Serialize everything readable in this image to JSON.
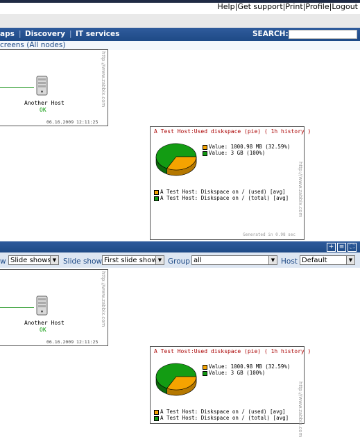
{
  "header": {
    "links": [
      "Help",
      "Get support",
      "Print",
      "Profile",
      "Logout"
    ]
  },
  "menu": {
    "items": [
      "aps",
      "Discovery",
      "IT services"
    ],
    "search_label": "SEARCH:",
    "search_value": ""
  },
  "breadcrumb": "creens (All nodes)",
  "map": {
    "host_label": "Another Host",
    "status": "OK",
    "timestamp": "06.16.2009 12:11:25",
    "watermark": "http://www.zabbix.com"
  },
  "graph": {
    "title": "A Test Host:Used diskspace (pie) ( 1h history )",
    "value_used": "Value: 1000.98 MB (32.59%)",
    "value_total": "Value: 3 GB (100%)",
    "legend_used": "A Test Host: Diskspace on / (used)  [avg]",
    "legend_total": "A Test Host: Diskspace on / (total) [avg]",
    "generated": "Generated in 0.98 sec",
    "watermark": "http://www.zabbix.com"
  },
  "chart_data": {
    "type": "pie",
    "title": "A Test Host:Used diskspace (pie) ( 1h history )",
    "series": [
      {
        "name": "A Test Host: Diskspace on / (used) [avg]",
        "value": 1000.98,
        "unit": "MB",
        "percent": 32.59
      },
      {
        "name": "A Test Host: Diskspace on / (total) [avg]",
        "value": 3,
        "unit": "GB",
        "percent": 100
      }
    ],
    "colors": {
      "used": "#f5a300",
      "total": "#139c13"
    }
  },
  "controls": {
    "view_label": "w",
    "view_value": "Slide shows",
    "slideshow_label": "Slide show",
    "slideshow_value": "First slide show",
    "group_label": "Group",
    "group_value": "all",
    "host_label": "Host",
    "host_value": "Default"
  },
  "colors": {
    "menu_blue": "#1e4a86",
    "status_ok": "#0a9a0a",
    "title_red": "#aa0000"
  }
}
